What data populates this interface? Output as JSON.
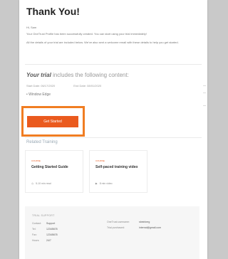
{
  "header": {
    "title": "Thank You!"
  },
  "intro": {
    "greeting": "Hi, Sam",
    "paragraph1": "Your OneTrust Profile has been successfully created. You can start using your trial immediately!",
    "paragraph2": "All the details of your trial are included below. We've also sent a welcome email with these details to help you get started."
  },
  "trial": {
    "prefix": "Your trial",
    "suffix": "includes the following content:",
    "start_date": "Start Date: 06/17/2020",
    "end_date": "End Date: 08/01/2020",
    "items": [
      "Window Edge"
    ],
    "cta_label": "Get Started"
  },
  "training": {
    "section_title": "Related Training",
    "cards": [
      {
        "kicker": "COURSE",
        "title": "Getting Started Guide",
        "meta": "5-10 min read",
        "icon": "clock-icon"
      },
      {
        "kicker": "COURSE",
        "title": "Self-paced training video",
        "meta": "8 min video",
        "icon": "play-icon"
      }
    ]
  },
  "support": {
    "heading": "TRIAL SUPPORT",
    "left": [
      {
        "label": "Contact:",
        "value": "Support"
      },
      {
        "label": "Tel:",
        "value": "12345678"
      },
      {
        "label": "Fax:",
        "value": "12345678"
      },
      {
        "label": "Hours:",
        "value": "24/7"
      }
    ],
    "right": [
      {
        "label": "OneTrust username:",
        "value": "sbeinberg"
      },
      {
        "label": "Trial purchased:",
        "value": "internal@gmail.com"
      }
    ]
  },
  "colors": {
    "accent": "#ea5a1e",
    "highlight": "#f07d22"
  }
}
